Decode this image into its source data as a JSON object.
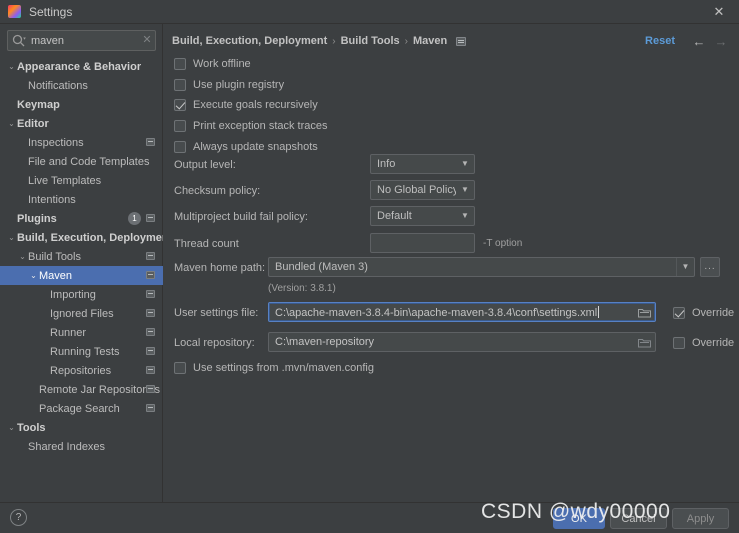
{
  "window": {
    "title": "Settings",
    "app_icon": "intellij-logo-icon",
    "close_icon": "✕"
  },
  "search": {
    "value": "maven",
    "placeholder": "",
    "search_icon": "search-icon",
    "clear_icon": "✕"
  },
  "sidebar": {
    "items": [
      {
        "label": "Appearance & Behavior",
        "indent": 0,
        "arrow": "⌄",
        "bold": true,
        "selected": false,
        "cfg": false,
        "badge": null
      },
      {
        "label": "Notifications",
        "indent": 1,
        "arrow": "",
        "bold": false,
        "selected": false,
        "cfg": false,
        "badge": null
      },
      {
        "label": "Keymap",
        "indent": 0,
        "arrow": "",
        "bold": true,
        "selected": false,
        "cfg": false,
        "badge": null
      },
      {
        "label": "Editor",
        "indent": 0,
        "arrow": "⌄",
        "bold": true,
        "selected": false,
        "cfg": false,
        "badge": null
      },
      {
        "label": "Inspections",
        "indent": 1,
        "arrow": "",
        "bold": false,
        "selected": false,
        "cfg": true,
        "badge": null
      },
      {
        "label": "File and Code Templates",
        "indent": 1,
        "arrow": "",
        "bold": false,
        "selected": false,
        "cfg": false,
        "badge": null
      },
      {
        "label": "Live Templates",
        "indent": 1,
        "arrow": "",
        "bold": false,
        "selected": false,
        "cfg": false,
        "badge": null
      },
      {
        "label": "Intentions",
        "indent": 1,
        "arrow": "",
        "bold": false,
        "selected": false,
        "cfg": false,
        "badge": null
      },
      {
        "label": "Plugins",
        "indent": 0,
        "arrow": "",
        "bold": true,
        "selected": false,
        "cfg": true,
        "badge": "1"
      },
      {
        "label": "Build, Execution, Deployment",
        "indent": 0,
        "arrow": "⌄",
        "bold": true,
        "selected": false,
        "cfg": false,
        "badge": null
      },
      {
        "label": "Build Tools",
        "indent": 1,
        "arrow": "⌄",
        "bold": false,
        "selected": false,
        "cfg": true,
        "badge": null
      },
      {
        "label": "Maven",
        "indent": 2,
        "arrow": "⌄",
        "bold": false,
        "selected": true,
        "cfg": true,
        "badge": null
      },
      {
        "label": "Importing",
        "indent": 3,
        "arrow": "",
        "bold": false,
        "selected": false,
        "cfg": true,
        "badge": null
      },
      {
        "label": "Ignored Files",
        "indent": 3,
        "arrow": "",
        "bold": false,
        "selected": false,
        "cfg": true,
        "badge": null
      },
      {
        "label": "Runner",
        "indent": 3,
        "arrow": "",
        "bold": false,
        "selected": false,
        "cfg": true,
        "badge": null
      },
      {
        "label": "Running Tests",
        "indent": 3,
        "arrow": "",
        "bold": false,
        "selected": false,
        "cfg": true,
        "badge": null
      },
      {
        "label": "Repositories",
        "indent": 3,
        "arrow": "",
        "bold": false,
        "selected": false,
        "cfg": true,
        "badge": null
      },
      {
        "label": "Remote Jar Repositories",
        "indent": 2,
        "arrow": "",
        "bold": false,
        "selected": false,
        "cfg": true,
        "badge": null
      },
      {
        "label": "Package Search",
        "indent": 2,
        "arrow": "",
        "bold": false,
        "selected": false,
        "cfg": true,
        "badge": null
      },
      {
        "label": "Tools",
        "indent": 0,
        "arrow": "⌄",
        "bold": true,
        "selected": false,
        "cfg": false,
        "badge": null
      },
      {
        "label": "Shared Indexes",
        "indent": 1,
        "arrow": "",
        "bold": false,
        "selected": false,
        "cfg": false,
        "badge": null
      }
    ]
  },
  "breadcrumb": {
    "parts": [
      "Build, Execution, Deployment",
      "Build Tools",
      "Maven"
    ],
    "separator": "›",
    "menu_icon": "hamburger-icon",
    "reset_label": "Reset",
    "back_icon": "←",
    "forward_icon": "→"
  },
  "main": {
    "checkboxes": [
      {
        "label": "Work offline",
        "checked": false
      },
      {
        "label": "Use plugin registry",
        "checked": false
      },
      {
        "label": "Execute goals recursively",
        "checked": true
      },
      {
        "label": "Print exception stack traces",
        "checked": false
      },
      {
        "label": "Always update snapshots",
        "checked": false
      }
    ],
    "output_level": {
      "label": "Output level:",
      "value": "Info"
    },
    "checksum_policy": {
      "label": "Checksum policy:",
      "value": "No Global Policy"
    },
    "multiproject_policy": {
      "label": "Multiproject build fail policy:",
      "value": "Default"
    },
    "thread_count": {
      "label": "Thread count",
      "value": "",
      "hint": "-T option"
    },
    "maven_home": {
      "label": "Maven home path:",
      "value": "Bundled (Maven 3)",
      "version": "(Version: 3.8.1)",
      "browse_label": "..."
    },
    "user_settings": {
      "label": "User settings file:",
      "value": "C:\\apache-maven-3.8.4-bin\\apache-maven-3.8.4\\conf\\settings.xml",
      "override_label": "Override",
      "override_checked": true
    },
    "local_repository": {
      "label": "Local repository:",
      "value": "C:\\maven-repository",
      "override_label": "Override",
      "override_checked": false
    },
    "mvn_config": {
      "label": "Use settings from .mvn/maven.config",
      "checked": false
    }
  },
  "footer": {
    "help_label": "?",
    "ok_label": "OK",
    "cancel_label": "Cancel",
    "apply_label": "Apply"
  },
  "watermark": {
    "text": "CSDN @wdy00000"
  },
  "colors": {
    "background": "#3c3f41",
    "selection": "#4b6eaf",
    "link": "#5c9bd8",
    "field": "#45494a",
    "focus_border": "#5781c4"
  }
}
